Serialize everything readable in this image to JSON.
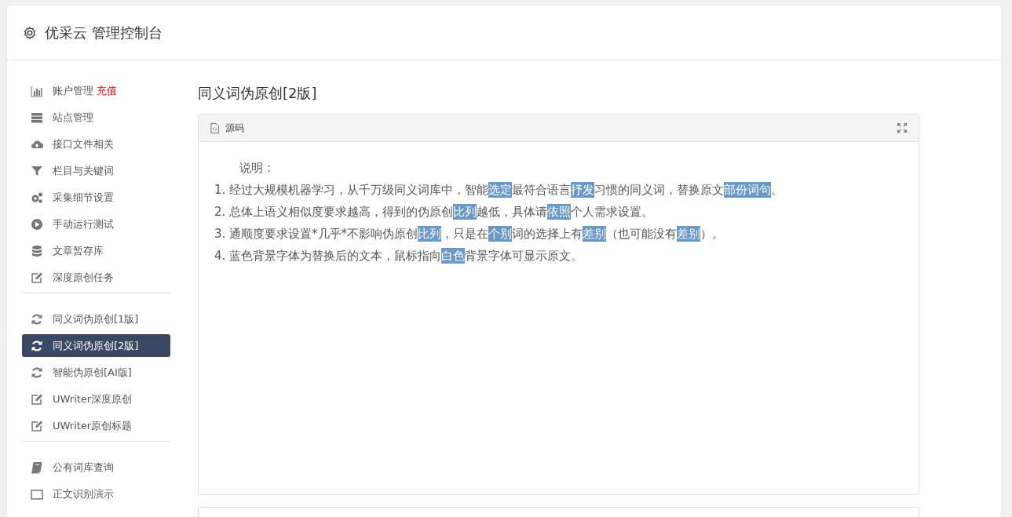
{
  "header": {
    "title": "优采云 管理控制台"
  },
  "sidebar": {
    "groups": [
      {
        "items": [
          {
            "label": "账户管理",
            "badge": "充值",
            "selected": false
          },
          {
            "label": "站点管理",
            "selected": false
          },
          {
            "label": "接口文件相关",
            "selected": false
          },
          {
            "label": "栏目与关键词",
            "selected": false
          },
          {
            "label": "采集细节设置",
            "selected": false
          },
          {
            "label": "手动运行测试",
            "selected": false
          },
          {
            "label": "文章暂存库",
            "selected": false
          },
          {
            "label": "深度原创任务",
            "selected": false
          }
        ]
      },
      {
        "items": [
          {
            "label": "同义词伪原创[1版]",
            "selected": false
          },
          {
            "label": "同义词伪原创[2版]",
            "selected": true
          },
          {
            "label": "智能伪原创[AI版]",
            "selected": false
          },
          {
            "label": "UWriter深度原创",
            "selected": false
          },
          {
            "label": "UWriter原创标题",
            "selected": false
          }
        ]
      },
      {
        "items": [
          {
            "label": "公有词库查询",
            "selected": false
          },
          {
            "label": "正文识别演示",
            "selected": false
          }
        ]
      }
    ]
  },
  "page_title": "同义词伪原创[2版]",
  "panel": {
    "tab": "源码",
    "heading": "说明：",
    "lines": [
      [
        {
          "text": "1. 经过大规模机器学习，从千万级同义词库中，智能",
          "highlight": false
        },
        {
          "text": "选定",
          "highlight": true
        },
        {
          "text": "最符合语言",
          "highlight": false
        },
        {
          "text": "抒发",
          "highlight": true
        },
        {
          "text": "习惯的同义词，替换原文",
          "highlight": false
        },
        {
          "text": "部份",
          "highlight": true
        },
        {
          "text": "词句",
          "highlight": true
        },
        {
          "text": "。",
          "highlight": false
        }
      ],
      [
        {
          "text": "2. 总体上语义相似度要求越高，得到的伪原创",
          "highlight": false
        },
        {
          "text": "比列",
          "highlight": true
        },
        {
          "text": "越低，具体请",
          "highlight": false
        },
        {
          "text": "依照",
          "highlight": true
        },
        {
          "text": "个人需求设置。",
          "highlight": false
        }
      ],
      [
        {
          "text": "3. 通顺度要求设置*几乎*不影响伪原创",
          "highlight": false
        },
        {
          "text": "比列",
          "highlight": true
        },
        {
          "text": "，只是在",
          "highlight": false
        },
        {
          "text": "个别",
          "highlight": true
        },
        {
          "text": "词的选择上有",
          "highlight": false
        },
        {
          "text": "差别",
          "highlight": true
        },
        {
          "text": "（也可能没有",
          "highlight": false
        },
        {
          "text": "差别",
          "highlight": true
        },
        {
          "text": "）。",
          "highlight": false
        }
      ],
      [
        {
          "text": "4. 蓝色背景字体为替换后的文本，鼠标指向",
          "highlight": false
        },
        {
          "text": "白色",
          "highlight": true
        },
        {
          "text": "背景字体可显示原文。",
          "highlight": false
        }
      ]
    ]
  }
}
